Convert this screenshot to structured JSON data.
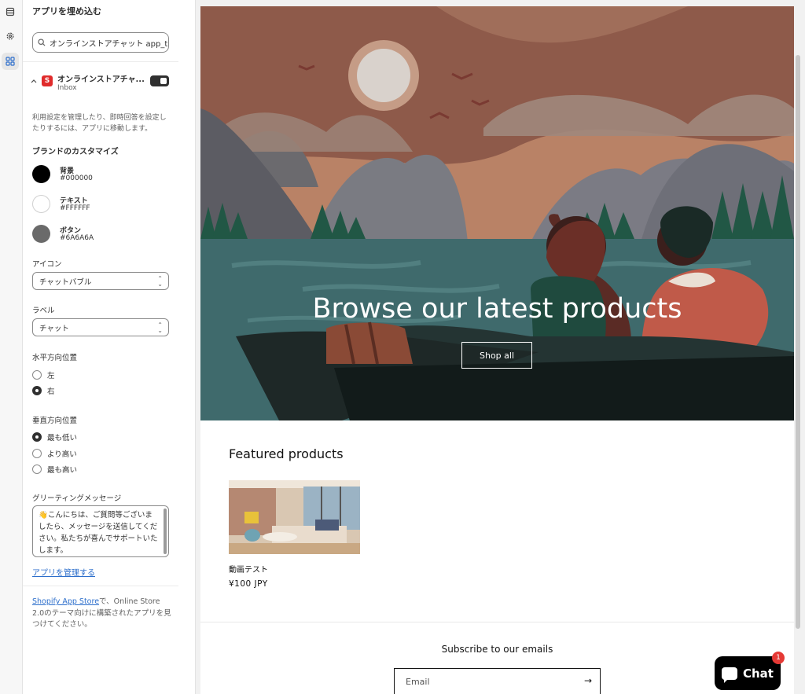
{
  "sidebar_rail": {
    "icons": [
      "sections-icon",
      "settings-gear-icon",
      "apps-icon"
    ]
  },
  "panel": {
    "title": "アプリを埋め込む",
    "search_value": "オンラインストアチャット app_ti",
    "app": {
      "name": "オンラインストアチャ...",
      "subtitle": "Inbox",
      "enabled": true
    },
    "help_text": "利用設定を管理したり、即時回答を設定したりするには、アプリに移動します。",
    "brand_section_title": "ブランドのカスタマイズ",
    "colors": [
      {
        "label": "背景",
        "hex": "#000000"
      },
      {
        "label": "テキスト",
        "hex": "#FFFFFF"
      },
      {
        "label": "ボタン",
        "hex": "#6A6A6A"
      }
    ],
    "icon_label": "アイコン",
    "icon_value": "チャットバブル",
    "label_label": "ラベル",
    "label_value": "チャット",
    "horizontal_label": "水平方向位置",
    "horizontal_options": [
      {
        "label": "左",
        "checked": false
      },
      {
        "label": "右",
        "checked": true
      }
    ],
    "vertical_label": "垂直方向位置",
    "vertical_options": [
      {
        "label": "最も低い",
        "checked": true
      },
      {
        "label": "より高い",
        "checked": false
      },
      {
        "label": "最も高い",
        "checked": false
      }
    ],
    "greeting_label": "グリーティングメッセージ",
    "greeting_value": "👋こんにちは、ご質問等ございましたら、メッセージを送信してください。私たちが喜んでサポートいたします。",
    "manage_link": "アプリを管理する",
    "footer_link": "Shopify App Store",
    "footer_text": "で、Online Store 2.0のテーマ向けに構築されたアプリを見つけてください。"
  },
  "preview": {
    "hero_title": "Browse our latest products",
    "hero_button": "Shop all",
    "featured_title": "Featured products",
    "product": {
      "name": "動画テスト",
      "price": "¥100 JPY"
    },
    "subscribe_title": "Subscribe to our emails",
    "email_placeholder": "Email",
    "email_submit_icon": "arrow-right-icon"
  },
  "chat_widget": {
    "label": "Chat",
    "badge": "1"
  }
}
